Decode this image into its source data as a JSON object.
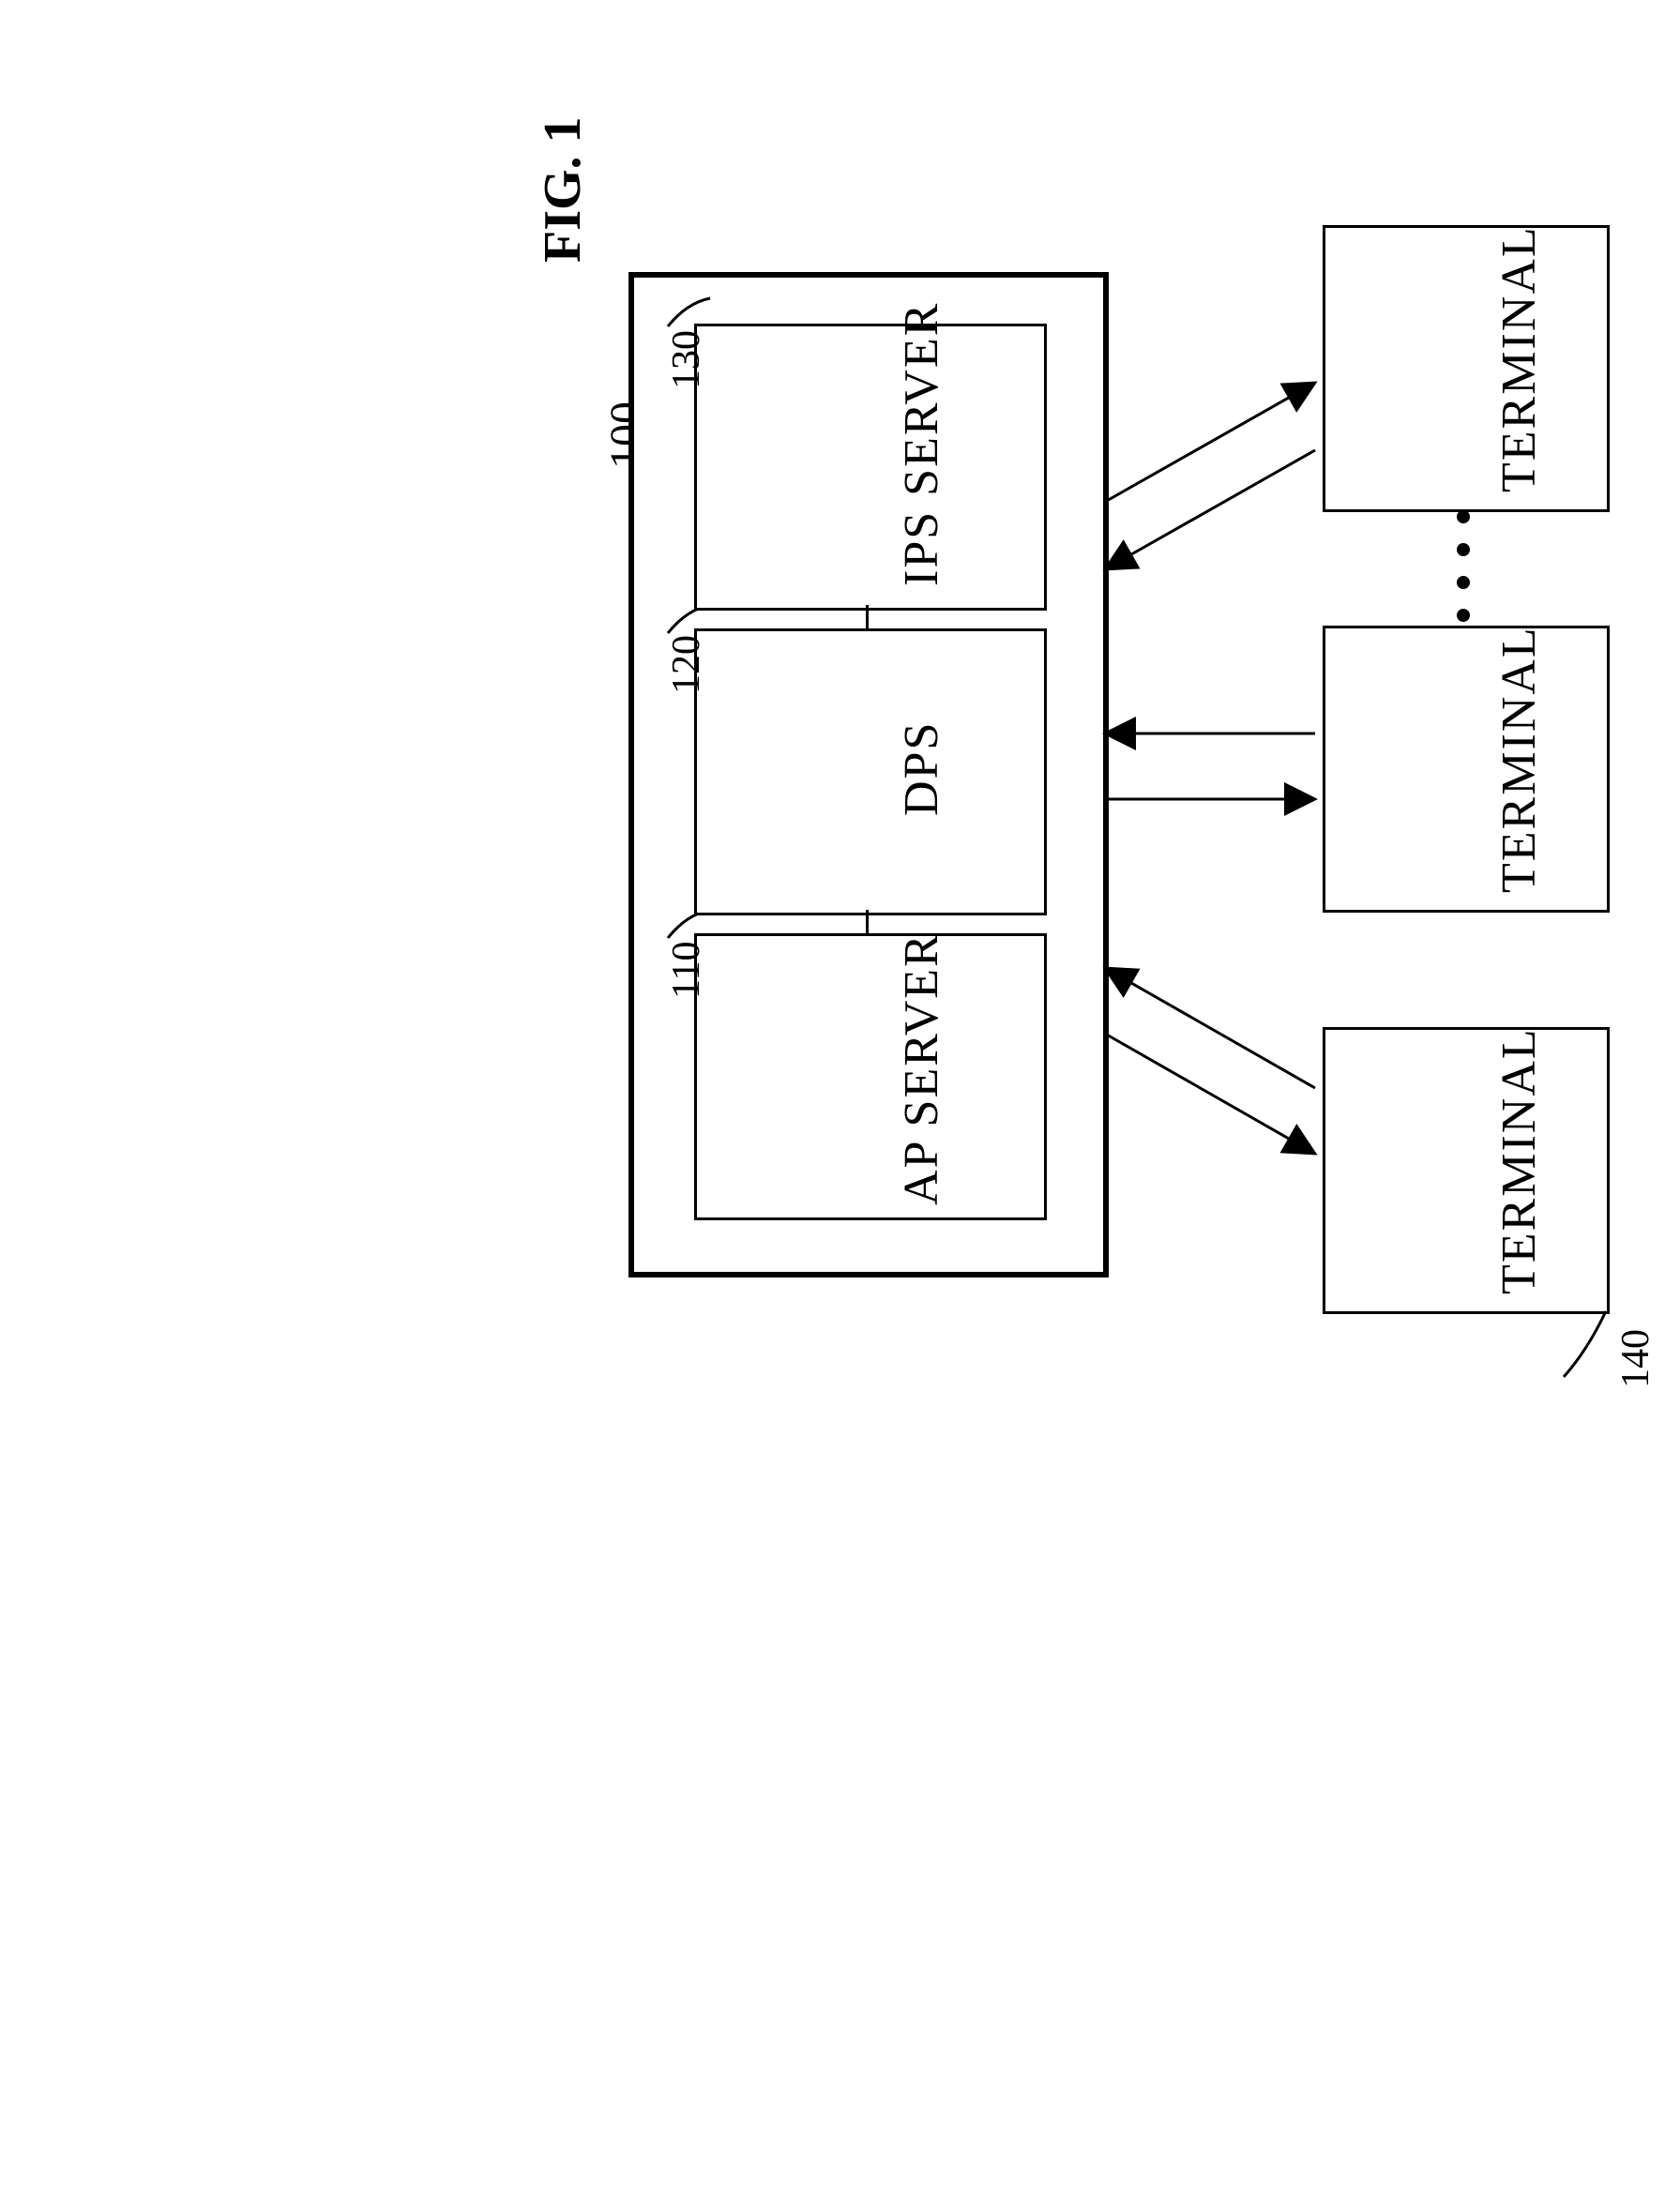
{
  "figure": {
    "title": "FIG. 1"
  },
  "refs": {
    "system": "100",
    "ap_server": "110",
    "dps": "120",
    "ips_server": "130",
    "terminal": "140"
  },
  "blocks": {
    "ap_server": "AP SERVER",
    "dps": "DPS",
    "ips_server": "IPS SERVER",
    "terminal1": "TERMINAL",
    "terminal2": "TERMINAL",
    "terminal3": "TERMINAL"
  }
}
